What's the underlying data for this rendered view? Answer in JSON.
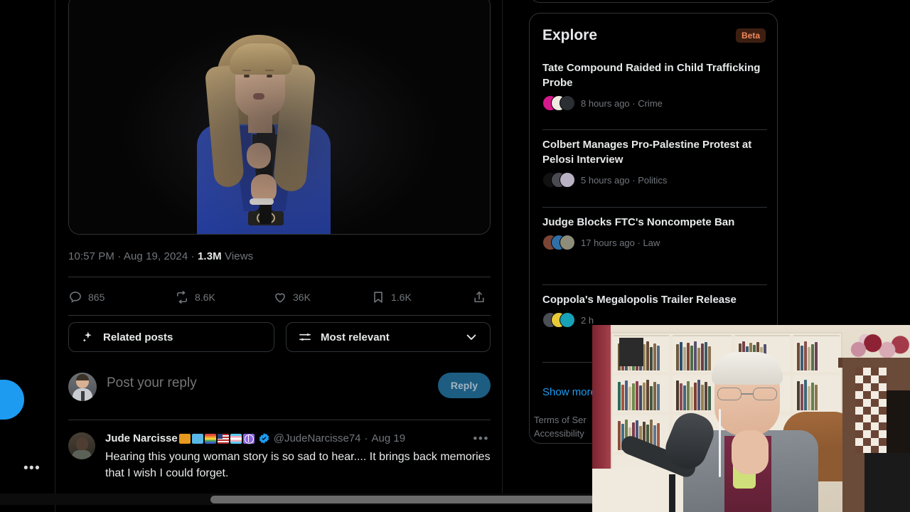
{
  "post": {
    "timestamp": "10:57 PM",
    "date": "Aug 19, 2024",
    "views_count": "1.3M",
    "views_label": "Views",
    "separator": "·",
    "media_alt": "Woman in blue blazer speaking into a microphone on a dark stage"
  },
  "actions": {
    "reply": {
      "icon": "comment-icon",
      "count": "865"
    },
    "repost": {
      "icon": "repost-icon",
      "count": "8.6K"
    },
    "like": {
      "icon": "heart-icon",
      "count": "36K"
    },
    "bookmark": {
      "icon": "bookmark-icon",
      "count": "1.6K"
    },
    "share": {
      "icon": "share-icon",
      "count": ""
    }
  },
  "filters": {
    "related_posts_label": "Related posts",
    "related_posts_icon": "sparkle-icon",
    "sort_label": "Most relevant",
    "sort_icon": "sliders-icon",
    "chevron_icon": "chevron-down-icon"
  },
  "composer": {
    "placeholder": "Post your reply",
    "reply_button_label": "Reply",
    "avatar_alt": "Man in light gray suit"
  },
  "reply": {
    "display_name": "Jude Narcisse",
    "emoji": [
      "orange-square",
      "blue-square",
      "rainbow-flag",
      "us-flag",
      "trans-flag",
      "peace-symbol"
    ],
    "verified_icon": "verified-badge-icon",
    "handle": "@JudeNarcisse74",
    "separator": "·",
    "date": "Aug 19",
    "more_icon": "more-options-icon",
    "text": "Hearing this young woman story is so sad to hear.... It brings back memories that I wish I could forget."
  },
  "explore": {
    "title": "Explore",
    "badge": "Beta",
    "show_more": "Show more",
    "stories": [
      {
        "title": "Tate Compound Raided in Child Trafficking Probe",
        "meta": "8 hours ago · Crime",
        "avatar_colors": [
          "#d6198a",
          "#efeae2",
          "#2b2f33"
        ]
      },
      {
        "title": "Colbert Manages Pro-Palestine Protest at Pelosi Interview",
        "meta": "5 hours ago · Politics",
        "avatar_colors": [
          "#111111",
          "#4a4a52",
          "#b9b2c4"
        ]
      },
      {
        "title": "Judge Blocks FTC's Noncompete Ban",
        "meta": "17 hours ago · Law",
        "avatar_colors": [
          "#7a4436",
          "#2f6fa8",
          "#8d8d7a"
        ]
      },
      {
        "title": "Coppola's Megalopolis Trailer Release",
        "meta": "2 h",
        "avatar_colors": [
          "#4a4e55",
          "#e8c93a",
          "#17a2b8"
        ]
      }
    ]
  },
  "footer": {
    "line1": "Terms of Ser",
    "line2": "Accessibility"
  },
  "rail": {
    "compose_icon": "compose-button",
    "more_icon": "more-menu-icon"
  },
  "colors": {
    "accent_blue": "#1d9bf0",
    "reply_button": "#1d5d82",
    "beta_bg": "#3d1f12",
    "beta_text": "#f08a5d",
    "muted_text": "#71767b",
    "border": "#2f3336",
    "background": "#000000"
  },
  "scrollbar": {
    "orientation": "horizontal"
  }
}
